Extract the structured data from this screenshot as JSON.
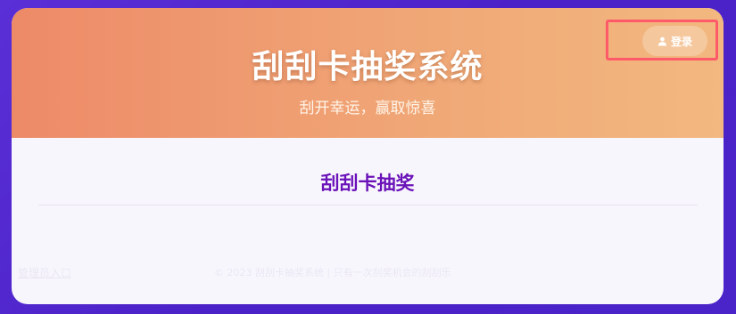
{
  "header": {
    "title": "刮刮卡抽奖系统",
    "subtitle": "刮开幸运，赢取惊喜",
    "login_label": "登录"
  },
  "main": {
    "section_title": "刮刮卡抽奖"
  },
  "footer": {
    "admin_link": "管理员入口",
    "copyright": "© 2023 刮刮卡抽奖系统 | 只有一次刮奖机会的刮刮乐"
  },
  "colors": {
    "accent": "#6a12b8",
    "header_start": "#ed8a68",
    "header_end": "#f2b87f",
    "highlight": "#ff5a6a"
  },
  "icons": {
    "login": "user-icon"
  }
}
